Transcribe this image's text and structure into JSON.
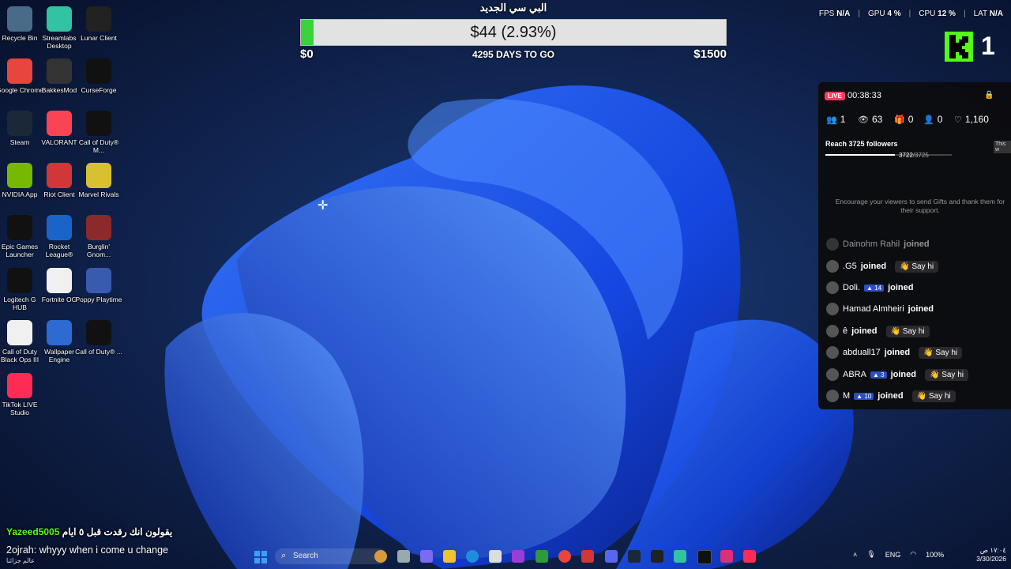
{
  "desktop_icons": [
    {
      "label": "Recycle Bin",
      "icon": "recycle-bin-icon",
      "color": "#4a6a8a"
    },
    {
      "label": "Streamlabs Desktop",
      "icon": "streamlabs-icon",
      "color": "#31c3a2"
    },
    {
      "label": "Lunar Client",
      "icon": "lunar-client-icon",
      "color": "#222"
    },
    {
      "label": "Google Chrome",
      "icon": "chrome-icon",
      "color": "#e8453c"
    },
    {
      "label": "BakkesMod",
      "icon": "bakkesmod-icon",
      "color": "#333"
    },
    {
      "label": "CurseForge",
      "icon": "curseforge-icon",
      "color": "#111"
    },
    {
      "label": "Steam",
      "icon": "steam-icon",
      "color": "#1b2838"
    },
    {
      "label": "VALORANT",
      "icon": "valorant-icon",
      "color": "#fa4454"
    },
    {
      "label": "Call of Duty® M...",
      "icon": "cod-mw-icon",
      "color": "#111"
    },
    {
      "label": "NVIDIA App",
      "icon": "nvidia-icon",
      "color": "#76b900"
    },
    {
      "label": "Riot Client",
      "icon": "riot-client-icon",
      "color": "#d13639"
    },
    {
      "label": "Marvel Rivals",
      "icon": "marvel-rivals-icon",
      "color": "#d8c030"
    },
    {
      "label": "Epic Games Launcher",
      "icon": "epic-games-icon",
      "color": "#111"
    },
    {
      "label": "Rocket League®",
      "icon": "rocket-league-icon",
      "color": "#1a64c8"
    },
    {
      "label": "Burglin' Gnom...",
      "icon": "burglin-gnomes-icon",
      "color": "#8b2a2a"
    },
    {
      "label": "Logitech G HUB",
      "icon": "logitech-icon",
      "color": "#111"
    },
    {
      "label": "Fortnite OG",
      "icon": "file-icon",
      "color": "#f0f0f0"
    },
    {
      "label": "Poppy Playtime",
      "icon": "poppy-playtime-icon",
      "color": "#3a5ab0"
    },
    {
      "label": "Call of Duty Black Ops III",
      "icon": "file-icon",
      "color": "#f0f0f0"
    },
    {
      "label": "Wallpaper Engine",
      "icon": "wallpaper-engine-icon",
      "color": "#2d6ad1"
    },
    {
      "label": "Call of Duty® ...",
      "icon": "cod-icon",
      "color": "#111"
    },
    {
      "label": "TikTok LIVE Studio",
      "icon": "tiktok-icon",
      "color": "#fe2c55"
    }
  ],
  "goal": {
    "title": "البي سي الجديد",
    "amount": "$44 (2.93%)",
    "progress_fraction": 0.0293,
    "start": "$0",
    "end": "$1500",
    "days": "4295 DAYS TO GO"
  },
  "stats": {
    "fps_label": "FPS",
    "fps_value": "N/A",
    "gpu_label": "GPU",
    "gpu_value": "4 %",
    "cpu_label": "CPU",
    "cpu_value": "12 %",
    "lat_label": "LAT",
    "lat_value": "N/A"
  },
  "kick_count": "1",
  "panel": {
    "live_badge": "LIVE",
    "time": "00:38:33",
    "metrics": [
      "1",
      "63",
      "0",
      "0",
      "1,160"
    ],
    "reach_label": "Reach 3725 followers",
    "reach_count": "3722",
    "reach_total": "/3725",
    "reach_fraction": 0.9992,
    "this_tag": "This w",
    "encourage": "Encourage your viewers to send Gifts and thank them for their support.",
    "feed": [
      {
        "name": "Dainohm Rahil",
        "badge": "",
        "say_hi": false
      },
      {
        "name": ".G5",
        "badge": "",
        "say_hi": true
      },
      {
        "name": "Doli.",
        "badge": "14",
        "say_hi": false
      },
      {
        "name": "Hamad Almheiri",
        "badge": "",
        "say_hi": false
      },
      {
        "name": "ê",
        "badge": "",
        "say_hi": true
      },
      {
        "name": "abduall17",
        "badge": "",
        "say_hi": true
      },
      {
        "name": "ABRA",
        "badge": "3",
        "say_hi": true
      },
      {
        "name": "M",
        "badge": "10",
        "say_hi": true
      }
    ],
    "joined": "joined",
    "say_hi": "Say hi"
  },
  "chat": {
    "line1_user": "Yazeed5005",
    "line1_text": "يقولون انك رقدت قبل ٥ ايام",
    "line2": "2ojrah: whyyy when i come u change",
    "line3": "عالم جزائنا"
  },
  "taskbar": {
    "search": "Search",
    "lang": "ENG",
    "battery": "100%",
    "time": "١٧:٠٤ ص",
    "date": "3/30/2026"
  }
}
